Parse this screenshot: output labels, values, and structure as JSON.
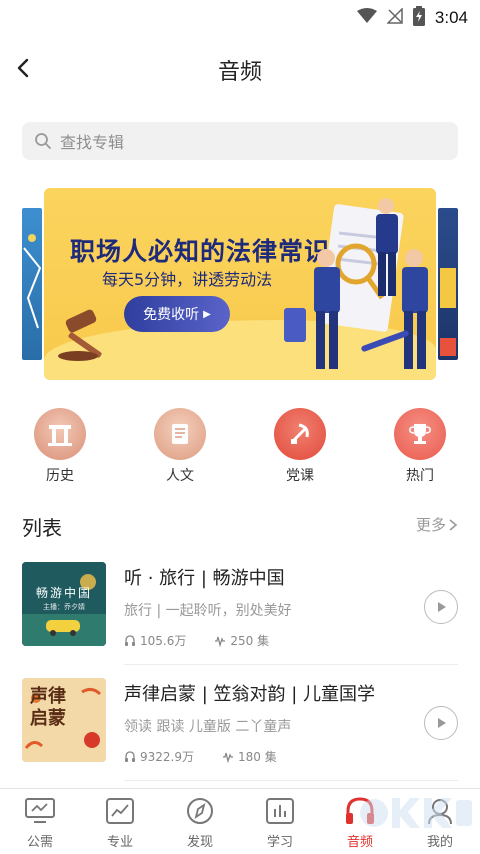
{
  "status_bar": {
    "time": "3:04"
  },
  "header": {
    "title": "音频"
  },
  "search": {
    "placeholder": "查找专辑"
  },
  "banner": {
    "title": "职场人必知的法律常识",
    "subtitle": "每天5分钟，讲透劳动法",
    "button_label": "免费收听"
  },
  "categories": [
    {
      "label": "历史",
      "icon": "history-gate-icon",
      "color": "#d98f77"
    },
    {
      "label": "人文",
      "icon": "scroll-icon",
      "color": "#dd9b80"
    },
    {
      "label": "党课",
      "icon": "party-emblem-icon",
      "color": "#e24a3b"
    },
    {
      "label": "热门",
      "icon": "trophy-icon",
      "color": "#ea5a4d"
    }
  ],
  "list": {
    "title": "列表",
    "more_label": "更多",
    "items": [
      {
        "name": "听 · 旅行 | 畅游中国",
        "desc": "旅行 | 一起聆听，别处美好",
        "plays": "105.6万",
        "episodes": "250 集",
        "cover_text": "畅游中国",
        "cover_subtext": "主播：乔夕婧"
      },
      {
        "name": "声律启蒙 | 笠翁对韵 | 儿童国学",
        "desc": "领读 跟读 儿童版 二丫童声",
        "plays": "9322.9万",
        "episodes": "180 集",
        "cover_text": "声律启蒙"
      }
    ]
  },
  "tabbar": {
    "tabs": [
      {
        "label": "公需",
        "icon": "monitor-icon",
        "active": false
      },
      {
        "label": "专业",
        "icon": "chart-icon",
        "active": false
      },
      {
        "label": "发现",
        "icon": "compass-icon",
        "active": false
      },
      {
        "label": "学习",
        "icon": "bar-chart-icon",
        "active": false
      },
      {
        "label": "音频",
        "icon": "headphones-icon",
        "active": true
      },
      {
        "label": "我的",
        "icon": "profile-icon",
        "active": false
      }
    ]
  },
  "colors": {
    "accent": "#e0312e",
    "banner_bg": "#f8c94b",
    "banner_text": "#1e2a7a"
  }
}
